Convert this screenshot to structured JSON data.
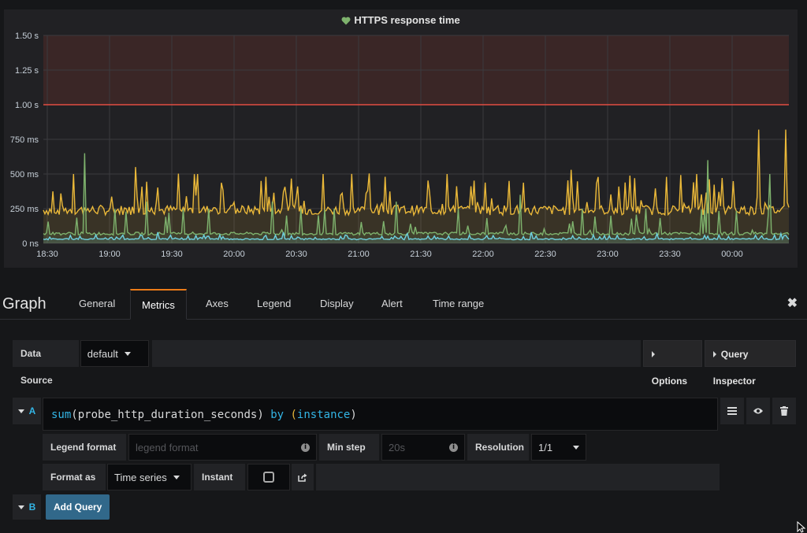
{
  "panel": {
    "title": "HTTPS response time",
    "y_ticks": [
      "1.50 s",
      "1.25 s",
      "1.00 s",
      "750 ms",
      "500 ms",
      "250 ms",
      "0 ns"
    ],
    "x_ticks": [
      "18:30",
      "19:00",
      "19:30",
      "20:00",
      "20:30",
      "21:00",
      "21:30",
      "22:00",
      "22:30",
      "23:00",
      "23:30",
      "00:00"
    ],
    "colors": {
      "yellow": "#eab839",
      "green": "#7eb26d",
      "blue": "#6ed0e0",
      "threshold": "#e24d42"
    }
  },
  "chart_data": {
    "type": "line",
    "x_range": [
      "18:30",
      "00:30"
    ],
    "ylim": [
      0,
      1.5
    ],
    "y_unit": "s",
    "threshold": 1.0,
    "series": [
      {
        "color": "#eab839",
        "baseline": 0.24,
        "spikes": [
          0.5,
          0.55,
          0.5,
          0.45,
          0.5,
          0.48,
          0.5,
          0.45,
          0.53,
          0.47,
          0.5,
          0.82
        ]
      },
      {
        "color": "#7eb26d",
        "baseline": 0.07,
        "spikes": [
          0.65,
          0.3,
          0.25,
          0.3,
          0.25,
          0.3,
          0.25,
          0.35,
          0.25,
          0.25,
          0.6,
          0.5
        ]
      },
      {
        "color": "#6ed0e0",
        "baseline": 0.03,
        "spikes": [
          0.06,
          0.08,
          0.06,
          0.08,
          0.06,
          0.07,
          0.06,
          0.08,
          0.06,
          0.07,
          0.06,
          0.07
        ]
      }
    ]
  },
  "editor": {
    "title": "Graph",
    "tabs": [
      "General",
      "Metrics",
      "Axes",
      "Legend",
      "Display",
      "Alert",
      "Time range"
    ],
    "active_tab": "Metrics",
    "close": "✖"
  },
  "datasource": {
    "label": "Data Source",
    "value": "default",
    "options_btn": "Options",
    "inspector_btn": "Query Inspector"
  },
  "query_a": {
    "ref": "A",
    "expr_fn": "sum",
    "expr_open": "(",
    "expr_metric": "probe_http_duration_seconds",
    "expr_close": ")",
    "expr_by": "by",
    "expr_label_open": "(",
    "expr_label": "instance",
    "expr_label_close": ")",
    "legend_format_label": "Legend format",
    "legend_format_placeholder": "legend format",
    "min_step_label": "Min step",
    "min_step_placeholder": "20s",
    "resolution_label": "Resolution",
    "resolution_value": "1/1",
    "format_as_label": "Format as",
    "format_as_value": "Time series",
    "instant_label": "Instant"
  },
  "query_b": {
    "ref": "B",
    "add_query": "Add Query"
  }
}
